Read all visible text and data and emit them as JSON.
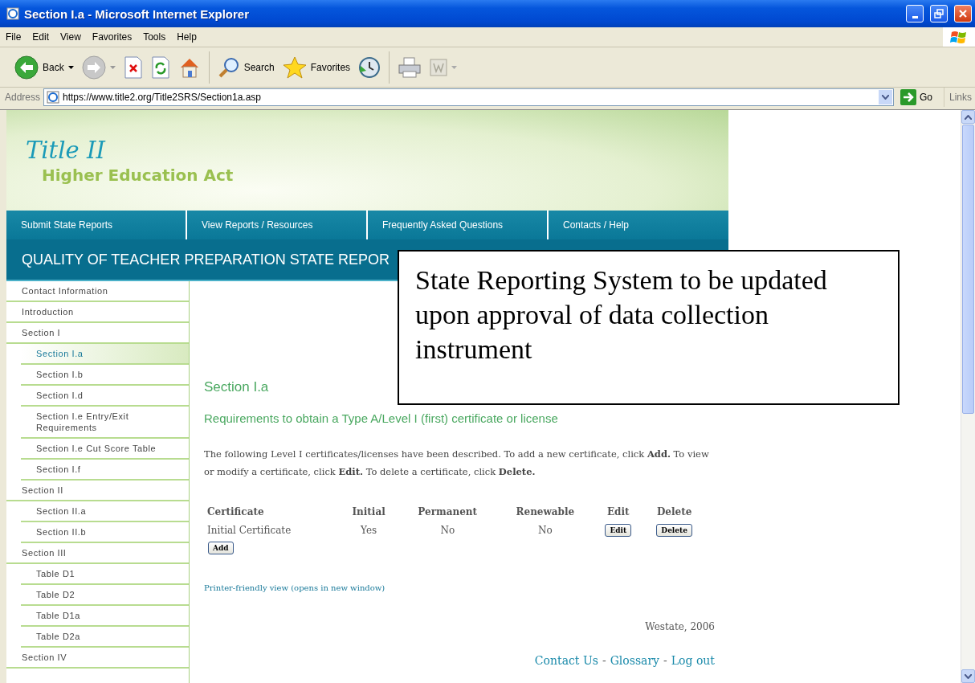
{
  "window": {
    "title": "Section I.a - Microsoft Internet Explorer"
  },
  "menu_bar": [
    "File",
    "Edit",
    "View",
    "Favorites",
    "Tools",
    "Help"
  ],
  "toolbar": {
    "back": "Back",
    "search": "Search",
    "favorites": "Favorites"
  },
  "address_bar": {
    "label": "Address",
    "url": "https://www.title2.org/Title2SRS/Section1a.asp",
    "go": "Go",
    "links": "Links"
  },
  "banner": {
    "title": "Title II",
    "subtitle": "Higher Education Act"
  },
  "nav": [
    "Submit State Reports",
    "View Reports / Resources",
    "Frequently Asked Questions",
    "Contacts / Help"
  ],
  "page_header": "QUALITY OF TEACHER PREPARATION STATE REPOR",
  "sidebar": {
    "items": [
      {
        "label": "Contact Information",
        "selected": false
      },
      {
        "label": "Introduction",
        "selected": false
      },
      {
        "label": "Section I",
        "selected": false,
        "children": [
          {
            "label": "Section I.a",
            "selected": true
          },
          {
            "label": "Section I.b",
            "selected": false
          },
          {
            "label": "Section I.d",
            "selected": false
          },
          {
            "label": "Section I.e Entry/Exit Requirements",
            "selected": false
          },
          {
            "label": "Section I.e Cut Score Table",
            "selected": false
          },
          {
            "label": "Section I.f",
            "selected": false
          }
        ]
      },
      {
        "label": "Section II",
        "selected": false,
        "children": [
          {
            "label": "Section II.a",
            "selected": false
          },
          {
            "label": "Section II.b",
            "selected": false
          }
        ]
      },
      {
        "label": "Section III",
        "selected": false,
        "children": [
          {
            "label": "Table D1",
            "selected": false
          },
          {
            "label": "Table D2",
            "selected": false
          },
          {
            "label": "Table D1a",
            "selected": false
          },
          {
            "label": "Table D2a",
            "selected": false
          }
        ]
      },
      {
        "label": "Section IV",
        "selected": false
      }
    ]
  },
  "main": {
    "heading": "Section I.a",
    "subheading": "Requirements to obtain a Type A/Level I (first) certificate or license",
    "intro": "The following Level I certificates/licenses have been described. To add a new certificate, click **Add.** To view or modify a certificate, click **Edit.** To delete a certificate, click **Delete.**",
    "table": {
      "columns": [
        "Certificate",
        "Initial",
        "Permanent",
        "Renewable",
        "Edit",
        "Delete"
      ],
      "rows": [
        {
          "certificate": "Initial Certificate",
          "initial": "Yes",
          "permanent": "No",
          "renewable": "No",
          "edit_button": "Edit",
          "delete_button": "Delete"
        }
      ]
    },
    "add_button": "Add",
    "printer_link": "Printer-friendly view (opens in new window)",
    "credit": "Westate, 2006",
    "footer": [
      {
        "kind": "link",
        "text": "Contact Us"
      },
      {
        "kind": "separator",
        "text": "-"
      },
      {
        "kind": "link",
        "text": "Glossary"
      },
      {
        "kind": "separator",
        "text": "-"
      },
      {
        "kind": "link",
        "text": "Log out"
      }
    ]
  },
  "callout": {
    "text": "State Reporting System to be updated upon approval of data collection instrument"
  }
}
